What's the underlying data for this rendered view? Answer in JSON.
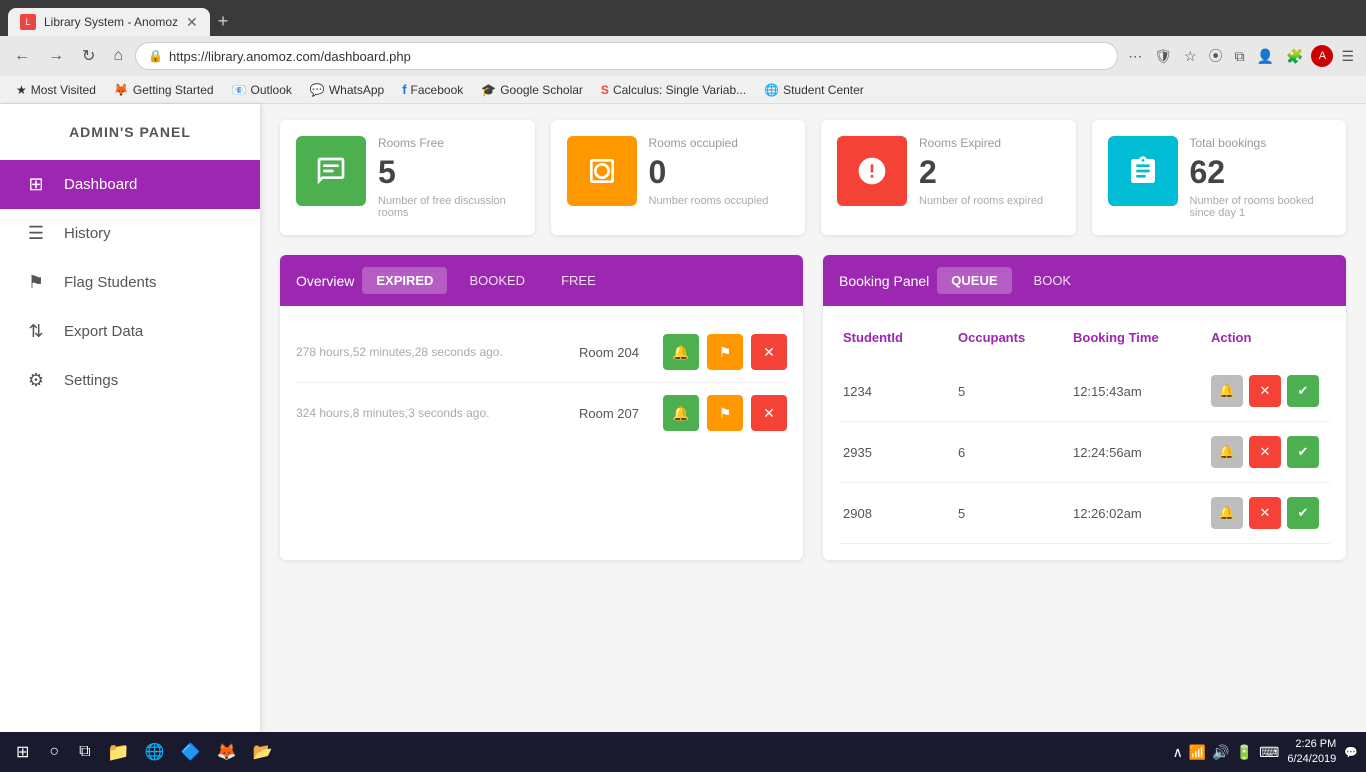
{
  "browser": {
    "tab_title": "Library System - Anomoz",
    "url": "https://library.anomoz.com/dashboard.php",
    "new_tab_icon": "+",
    "bookmarks": [
      {
        "label": "Most Visited",
        "icon": "★"
      },
      {
        "label": "Getting Started",
        "icon": "🦊"
      },
      {
        "label": "Outlook",
        "icon": "📧"
      },
      {
        "label": "WhatsApp",
        "icon": "📱"
      },
      {
        "label": "Facebook",
        "icon": "f"
      },
      {
        "label": "Google Scholar",
        "icon": "🎓"
      },
      {
        "label": "Calculus: Single Variab...",
        "icon": "S"
      },
      {
        "label": "Student Center",
        "icon": "🌐"
      }
    ]
  },
  "sidebar": {
    "title": "ADMIN'S PANEL",
    "items": [
      {
        "label": "Dashboard",
        "icon": "⊞",
        "active": true
      },
      {
        "label": "History",
        "icon": "☰",
        "active": false
      },
      {
        "label": "Flag Students",
        "icon": "⚑",
        "active": false
      },
      {
        "label": "Export Data",
        "icon": "⇅",
        "active": false
      },
      {
        "label": "Settings",
        "icon": "⚙",
        "active": false
      }
    ]
  },
  "stat_cards": [
    {
      "label": "Rooms Free",
      "value": "5",
      "desc": "Number of free discussion rooms",
      "color": "#4caf50",
      "icon": "🏪"
    },
    {
      "label": "Rooms occupied",
      "value": "0",
      "desc": "Number rooms occupied",
      "color": "#ff9800",
      "icon": "⧉"
    },
    {
      "label": "Rooms Expired",
      "value": "2",
      "desc": "Number of rooms expired",
      "color": "#f44336",
      "icon": "ℹ"
    },
    {
      "label": "Total bookings",
      "value": "62",
      "desc": "Number of rooms booked since day 1",
      "color": "#00bcd4",
      "icon": "📋"
    }
  ],
  "overview_panel": {
    "title": "Overview",
    "tabs": [
      "EXPIRED",
      "BOOKED",
      "FREE"
    ],
    "active_tab": "EXPIRED",
    "rows": [
      {
        "time": "278 hours,52 minutes,28 seconds ago.",
        "room": "Room 204"
      },
      {
        "time": "324 hours,8 minutes,3 seconds ago.",
        "room": "Room 207"
      }
    ]
  },
  "booking_panel": {
    "title": "Booking Panel",
    "tabs": [
      "QUEUE",
      "BOOK"
    ],
    "active_tab": "QUEUE",
    "columns": [
      "StudentId",
      "Occupants",
      "Booking Time",
      "Action"
    ],
    "rows": [
      {
        "student_id": "1234",
        "occupants": "5",
        "booking_time": "12:15:43am"
      },
      {
        "student_id": "2935",
        "occupants": "6",
        "booking_time": "12:24:56am"
      },
      {
        "student_id": "2908",
        "occupants": "5",
        "booking_time": "12:26:02am"
      }
    ]
  },
  "taskbar": {
    "time": "2:26 PM",
    "date": "6/24/2019",
    "icons": [
      "🔊",
      "📶",
      "🔋"
    ]
  }
}
